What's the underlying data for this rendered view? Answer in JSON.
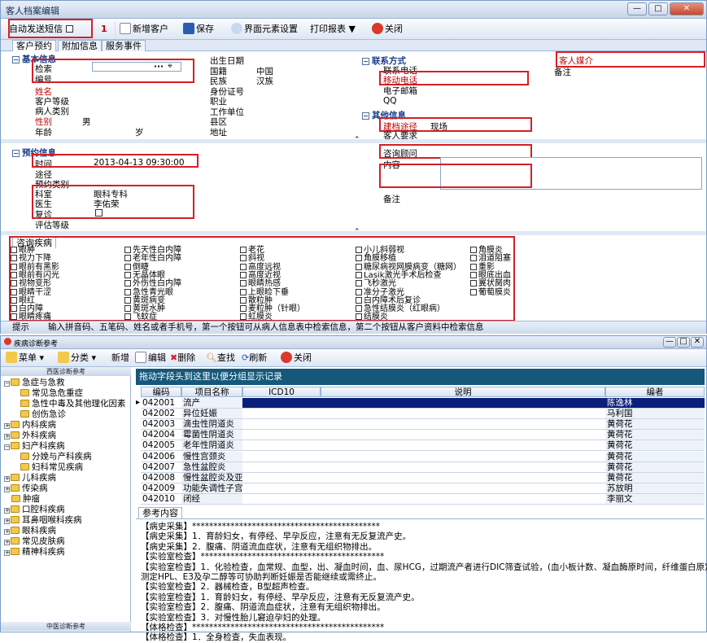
{
  "window1": {
    "title": "客人档案编辑",
    "controls": {
      "min": "—",
      "max": "□",
      "close": "✕"
    },
    "toolbar": {
      "auto_sms": "自动发送短信",
      "marker": "1",
      "new_customer": "新增客户",
      "save": "保存",
      "ui_settings": "界面元素设置",
      "print": "打印报表",
      "close": "关闭"
    },
    "tabs": [
      "客户预约",
      "附加信息",
      "服务事件"
    ],
    "basic": {
      "section": "基本信息",
      "search": "检索",
      "code": "编号",
      "name": "姓名",
      "level": "客户等级",
      "patient_type": "病人类别",
      "gender": "性别",
      "gender_value": "男",
      "age": "年龄",
      "age_unit": "岁",
      "birth": "出生日期",
      "nation_label": "国籍",
      "nation_value": "中国",
      "ethnic_label": "民族",
      "ethnic_value": "汉族",
      "id_card": "身份证号",
      "job": "职业",
      "workplace": "工作单位",
      "county": "县区",
      "address": "地址"
    },
    "contact": {
      "section": "联系方式",
      "phone": "联系电话",
      "mobile": "移动电话",
      "email": "电子邮箱",
      "qq": "QQ",
      "introducer": "客人媒介",
      "remark": "备注"
    },
    "other": {
      "section": "其他信息",
      "channel": "建档途径",
      "channel_value": "现场",
      "request": "客人要求"
    },
    "appt": {
      "section": "预约信息",
      "time": "时间",
      "time_value": "2013-04-13 09:30:00",
      "route": "途径",
      "type": "预约类别",
      "dept": "科室",
      "dept_value": "眼科专科",
      "doctor": "医生",
      "doctor_value": "李佑荣",
      "revisit": "复诊",
      "eval": "评估等级",
      "consultant": "咨询顾问",
      "content": "内容",
      "remark": "备注"
    },
    "disease_tab": "咨询疾病",
    "diseases": [
      [
        "眼肿",
        "视力下降",
        "眼前有黑影",
        "眼前有闪光",
        "视物变形",
        "眼睛干涩",
        "眼红",
        "白内障",
        "眼睛疼痛"
      ],
      [
        "先天性白内障",
        "老年性白内障",
        "倒睫",
        "无晶体眼",
        "外伤性白内障",
        "急性青光眼",
        "黄斑病变",
        "黄斑水肿",
        "飞蚊症"
      ],
      [
        "老花",
        "斜视",
        "高度远视",
        "高度近视",
        "眼睛热感",
        "上眼睑下垂",
        "散粒肿",
        "麦粒肿（针眼）",
        "虹膜炎"
      ],
      [
        "小儿斜弱视",
        "角膜移植",
        "糖尿病视网膜病变（糖网）",
        "Lasik激光手术后检查",
        "飞秒激光",
        "准分子激光",
        "白内障术后复诊",
        "急性结膜炎（红眼病）",
        "结膜炎"
      ],
      [
        "角膜炎",
        "泪道阻塞",
        "重影",
        "眼底出血",
        "翼状胬肉",
        "葡萄膜炎"
      ]
    ],
    "status": {
      "label": "提示",
      "text": "输入拼音码、五笔码、姓名或者手机号，第一个按钮可从病人信息表中检索信息，第二个按钮从客户资料中检索信息"
    }
  },
  "window2": {
    "title": "疾病诊断参考",
    "toolbar": {
      "menu": "菜单",
      "category": "分类",
      "add": "新增",
      "edit": "编辑",
      "delete": "删除",
      "find": "查找",
      "refresh": "刷新",
      "close": "关闭"
    },
    "tree_header": "西医诊断参考",
    "tree_footer": "中医诊断参考",
    "tree": [
      {
        "label": "急症与急救",
        "level": 0,
        "expanded": true
      },
      {
        "label": "常见急危重症",
        "level": 1
      },
      {
        "label": "急性中毒及其他理化因素",
        "level": 1
      },
      {
        "label": "创伤急诊",
        "level": 1
      },
      {
        "label": "内科疾病",
        "level": 0
      },
      {
        "label": "外科疾病",
        "level": 0
      },
      {
        "label": "妇产科疾病",
        "level": 0,
        "expanded": true
      },
      {
        "label": "分娩与产科疾病",
        "level": 1
      },
      {
        "label": "妇科常见疾病",
        "level": 1
      },
      {
        "label": "儿科疾病",
        "level": 0
      },
      {
        "label": "传染病",
        "level": 0
      },
      {
        "label": "肿瘤",
        "level": 0,
        "leaf": true
      },
      {
        "label": "口腔科疾病",
        "level": 0
      },
      {
        "label": "耳鼻咽喉科疾病",
        "level": 0
      },
      {
        "label": "眼科疾病",
        "level": 0
      },
      {
        "label": "常见皮肤病",
        "level": 0
      },
      {
        "label": "精神科疾病",
        "level": 0
      }
    ],
    "group_hint": "拖动字段头到这里以便分组显示记录",
    "columns": [
      "编码",
      "项目名称",
      "ICD10",
      "说明",
      "编者"
    ],
    "rows": [
      [
        "042001",
        "流产",
        "",
        "",
        "陈逸林"
      ],
      [
        "042002",
        "异位妊娠",
        "",
        "",
        "马利国"
      ],
      [
        "042003",
        "滴虫性阴道炎",
        "",
        "",
        "黄荷花"
      ],
      [
        "042004",
        "霉菌性阴道炎",
        "",
        "",
        "黄荷花"
      ],
      [
        "042005",
        "老年性阴道炎",
        "",
        "",
        "黄荷花"
      ],
      [
        "042006",
        "慢性宫颈炎",
        "",
        "",
        "黄荷花"
      ],
      [
        "042007",
        "急性盆腔炎",
        "",
        "",
        "黄荷花"
      ],
      [
        "042008",
        "慢性盆腔炎及亚急",
        "",
        "",
        "黄荷花"
      ],
      [
        "042009",
        "功能失调性子宫出",
        "",
        "",
        "苏放明"
      ],
      [
        "042010",
        "闭经",
        "",
        "",
        "李丽文"
      ]
    ],
    "ref_tab": "参考内容",
    "ref_lines": [
      "【病史采集】********************************************",
      "【病史采集】1．育龄妇女，有停经、早孕反应，注意有无反复流产史。",
      "【病史采集】2．腹痛、阴道流血症状，注意有无组织物排出。",
      "【实验室检查】*******************************************",
      "【实验室检查】1．化验检查，血常规、血型，出、凝血时间，血、尿HCG，过期流产者进行DIC筛查试验，(血小板计数、凝血酶原时间，纤维蛋白原定量)，",
      "测定HPL、E3及孕二醇等可协助判断妊娠是否能继续或需终止。",
      "【实验室检查】2．器械检查，B型超声检查。",
      "【实验室检查】1．育龄妇女，有停经、早孕反应，注意有无反复流产史。",
      "【实验室检查】2．腹痛、阴道流血症状，注意有无组织物排出。",
      "【实验室检查】3．对慢性胎儿窘迫孕妇的处理。",
      "【体格检查】*********************************************",
      "【体格检查】1．全身检查，失血表现。"
    ]
  }
}
